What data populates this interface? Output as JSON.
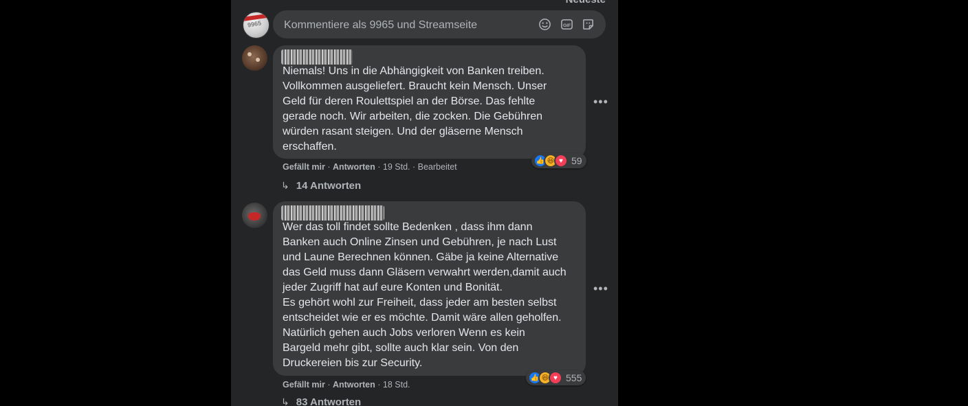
{
  "header": {
    "sort_label": "Neueste"
  },
  "composer": {
    "placeholder": "Kommentiere als 9965 und Streamseite",
    "avatar_text": "9965",
    "icons": [
      "emoji-icon",
      "gif-icon",
      "sticker-icon"
    ]
  },
  "comments": [
    {
      "text": "Niemals! Uns in die Abhängigkeit von Banken treiben.\nVollkommen ausgeliefert. Braucht kein Mensch. Unser\nGeld für deren Roulettspiel an der Börse. Das fehlte\ngerade noch. Wir arbeiten, die zocken. Die Gebühren\nwürden rasant steigen. Und der gläserne Mensch\nerschaffen.",
      "like_label": "Gefällt mir",
      "reply_label": "Antworten",
      "time": "19 Std.",
      "edited": "Bearbeitet",
      "reaction_count": "59",
      "reactions": [
        "like",
        "haha",
        "love"
      ],
      "replies_label": "14 Antworten"
    },
    {
      "text": "Wer das toll findet sollte Bedenken , dass ihm dann\nBanken auch Online Zinsen und Gebühren, je nach Lust\nund Laune Berechnen können. Gäbe ja keine Alternative\ndas Geld muss dann Gläsern verwahrt werden,damit auch\njeder Zugriff hat auf eure Konten und Bonität.\nEs gehört wohl zur Freiheit, dass jeder am besten selbst\nentscheidet wie er es möchte. Damit wäre allen geholfen.\nNatürlich gehen auch Jobs verloren Wenn es kein\nBargeld mehr gibt, sollte auch klar sein. Von den\nDruckereien bis zur Security.",
      "like_label": "Gefällt mir",
      "reply_label": "Antworten",
      "time": "18 Std.",
      "reaction_count": "555",
      "reactions": [
        "like",
        "haha",
        "love"
      ],
      "replies_label": "83 Antworten"
    }
  ],
  "colors": {
    "page_background": "#000000",
    "panel_background": "#242526",
    "bubble_background": "#3a3b3c",
    "primary_text": "#e4e6eb",
    "secondary_text": "#b0b3b8",
    "like_blue": "#1877f2",
    "haha_yellow": "#f7b125",
    "love_red": "#f33e58"
  }
}
